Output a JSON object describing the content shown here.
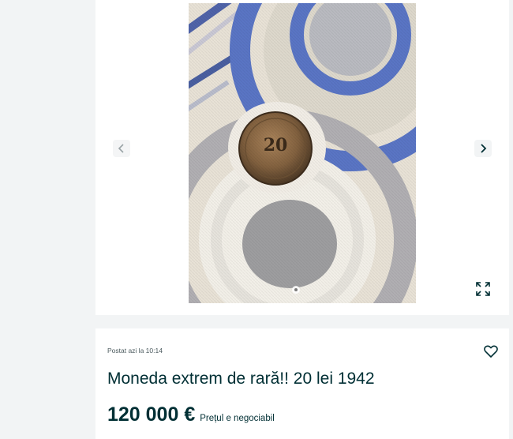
{
  "gallery": {
    "prev_icon": "chevron-left-icon",
    "next_icon": "chevron-right-icon",
    "expand_icon": "fullscreen-expand-icon",
    "image_subject": "coin",
    "coin_text": "20",
    "current_slide": 1,
    "colors": {
      "pattern_blue": "#5a75c4",
      "fabric": "#e8e2d6",
      "gray": "#a8a8aa"
    }
  },
  "listing": {
    "posted": "Postat azi la 10:14",
    "title": "Moneda extrem de rară!! 20 lei 1942",
    "price": "120 000 €",
    "negotiable": "Prețul e negociabil",
    "favorite_icon": "heart-outline-icon"
  },
  "colors": {
    "text_dark": "#002f34",
    "text_muted": "#4b5a5e",
    "page_bg": "#f2f4f5"
  }
}
